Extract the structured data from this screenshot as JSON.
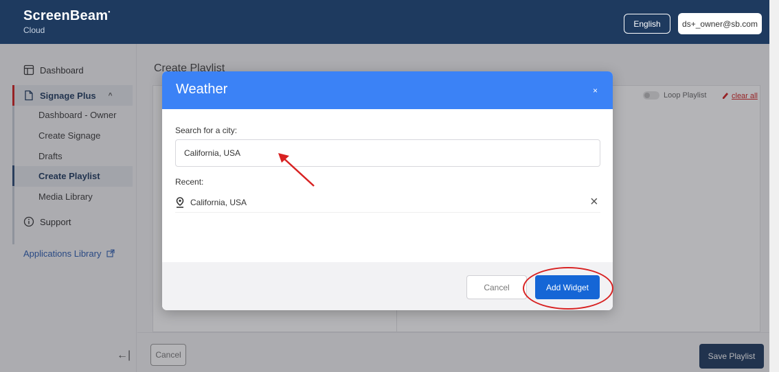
{
  "header": {
    "logo_main": "ScreenBeam",
    "logo_mark": "•",
    "logo_sub": "Cloud",
    "language": "English",
    "user_email": "ds+_owner@sb.com"
  },
  "sidebar": {
    "dashboard": "Dashboard",
    "signage_plus": "Signage Plus",
    "signage_plus_chevron": "^",
    "sub_items": [
      "Dashboard - Owner",
      "Create Signage",
      "Drafts",
      "Create Playlist",
      "Media Library"
    ],
    "support": "Support",
    "applications_library": "Applications Library",
    "collapse_icon_glyph": "←|"
  },
  "main": {
    "page_title": "Create Playlist",
    "loop_playlist": "Loop Playlist",
    "clear_all": "clear all"
  },
  "footer": {
    "cancel": "Cancel",
    "save": "Save Playlist"
  },
  "modal": {
    "title": "Weather",
    "close": "×",
    "search_label": "Search for a city:",
    "search_value": "California, USA",
    "recent_label": "Recent:",
    "recent_items": [
      "California, USA"
    ],
    "remove_glyph": "×",
    "cancel": "Cancel",
    "add_widget": "Add Widget"
  },
  "colors": {
    "header_bg": "#1e3a5f",
    "modal_header": "#3b82f6",
    "primary_button": "#1566d6",
    "annotation": "#d82222",
    "clear_all": "#d11f1f"
  },
  "icons": {
    "dashboard": "layout-icon",
    "signage": "document-icon",
    "support": "info-icon",
    "external_link": "external-link-icon",
    "location": "map-pin-icon",
    "pencil": "eraser-icon"
  }
}
